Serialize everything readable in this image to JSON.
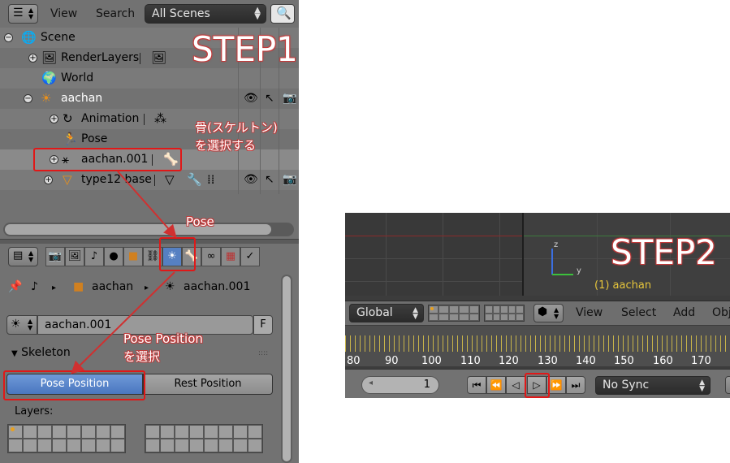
{
  "outliner": {
    "header": {
      "view_label": "View",
      "search_label": "Search",
      "scene_dropdown": "All Scenes"
    },
    "step_label": "STEP1",
    "rows": [
      {
        "label": "Scene"
      },
      {
        "label": "RenderLayers"
      },
      {
        "label": "World"
      },
      {
        "label": "aachan"
      },
      {
        "label": "Animation"
      },
      {
        "label": "Pose"
      },
      {
        "label": "aachan.001"
      },
      {
        "label": "type12 base"
      }
    ],
    "note_select_bone": "骨(スケルトン)\nを選択する"
  },
  "annotations": {
    "pose_label": "Pose",
    "pose_position_note_line1": "Pose Position",
    "pose_position_note_line2": "を選択"
  },
  "properties": {
    "path": {
      "object": "aachan",
      "armature": "aachan.001"
    },
    "name_field": "aachan.001",
    "fake_user": "F",
    "panel_title": "Skeleton",
    "pose_position_button": "Pose Position",
    "rest_position_button": "Rest Position",
    "layers_label": "Layers:"
  },
  "viewport": {
    "step_label": "STEP2",
    "object_name": "(1) aachan",
    "axis_z": "z",
    "axis_y": "y"
  },
  "header2": {
    "orientation": "Global",
    "view_label": "View",
    "select_label": "Select",
    "add_label": "Add",
    "object_label": "Obj"
  },
  "timeline": {
    "ticks": [
      "80",
      "90",
      "100",
      "110",
      "120",
      "130",
      "140",
      "150",
      "160",
      "170"
    ],
    "current_frame": "1",
    "sync_mode": "No Sync"
  }
}
